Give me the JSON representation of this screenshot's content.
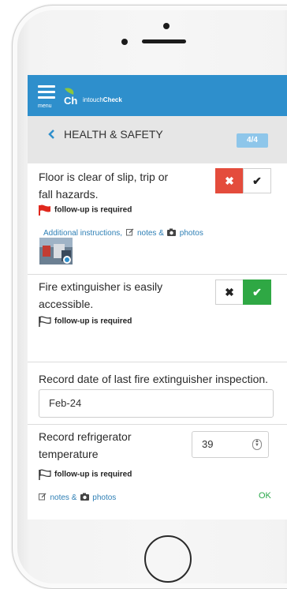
{
  "app": {
    "brand_plain": "intouch",
    "brand_bold": "Check",
    "menu_label": "menu"
  },
  "section": {
    "title": "HEALTH & SAFETY",
    "page": "4/4"
  },
  "items": [
    {
      "text_line1": "Floor is clear of slip, trip or",
      "text_line2": "fall hazards.",
      "followup": "follow-up is required",
      "answer": "fail",
      "additional_instructions": "Additional instructions,",
      "notes": "notes &",
      "photos": "photos"
    },
    {
      "text_line1": "Fire extinguisher is easily",
      "text_line2": "accessible.",
      "followup": "follow-up is required",
      "answer": "pass"
    },
    {
      "text": "Record date of last fire extinguisher inspection.",
      "value": "Feb-24"
    },
    {
      "text_line1": "Record refrigerator",
      "text_line2": "temperature",
      "value": "39",
      "followup": "follow-up is required",
      "notes": "notes &",
      "photos": "photos",
      "status": "OK"
    }
  ],
  "toggles": {
    "fail_symbol": "✖",
    "pass_symbol": "✔"
  },
  "colors": {
    "header": "#2e8fcc",
    "fail": "#e44c3c",
    "pass": "#2fa844",
    "flag_active": "#e0281d",
    "badge": "#8ec6ea"
  }
}
